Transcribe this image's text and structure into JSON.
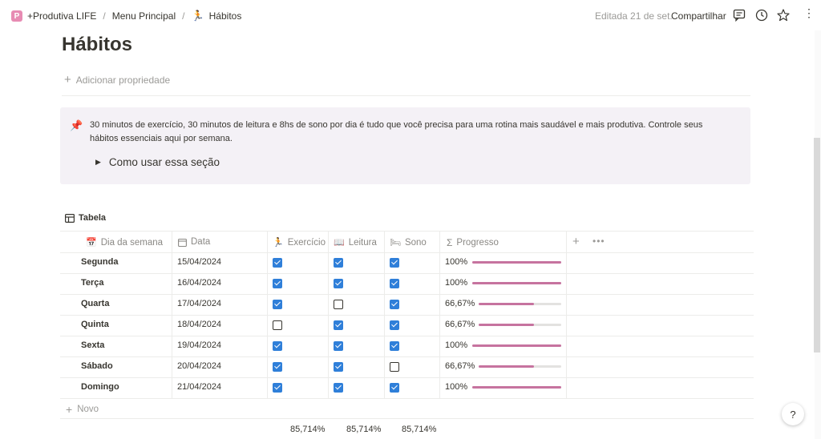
{
  "breadcrumb": {
    "workspace": "+Produtiva LIFE",
    "parent": "Menu Principal",
    "current": "Hábitos",
    "separator": "/"
  },
  "topbar": {
    "edited": "Editada 21 de set.",
    "share": "Compartilhar"
  },
  "page": {
    "title": "Hábitos",
    "add_property": "Adicionar propriedade"
  },
  "callout": {
    "icon": "pushpin-icon",
    "text": "30 minutos de exercício, 30 minutos de leitura e 8hs de sono por dia é tudo que você precisa para uma rotina mais saudável e mais produtiva. Controle seus hábitos essenciais aqui por semana.",
    "toggle_label": "Como usar essa seção"
  },
  "table": {
    "view_name": "Tabela",
    "headers": {
      "day": "Dia da semana",
      "date": "Data",
      "exercise": "Exercício",
      "reading": "Leitura",
      "sleep": "Sono",
      "progress": "Progresso"
    },
    "rows": [
      {
        "day": "Segunda",
        "date": "15/04/2024",
        "exercise": true,
        "reading": true,
        "sleep": true,
        "progress_label": "100%",
        "progress": 1.0
      },
      {
        "day": "Terça",
        "date": "16/04/2024",
        "exercise": true,
        "reading": true,
        "sleep": true,
        "progress_label": "100%",
        "progress": 1.0
      },
      {
        "day": "Quarta",
        "date": "17/04/2024",
        "exercise": true,
        "reading": false,
        "sleep": true,
        "progress_label": "66,67%",
        "progress": 0.6667
      },
      {
        "day": "Quinta",
        "date": "18/04/2024",
        "exercise": false,
        "reading": true,
        "sleep": true,
        "progress_label": "66,67%",
        "progress": 0.6667
      },
      {
        "day": "Sexta",
        "date": "19/04/2024",
        "exercise": true,
        "reading": true,
        "sleep": true,
        "progress_label": "100%",
        "progress": 1.0
      },
      {
        "day": "Sábado",
        "date": "20/04/2024",
        "exercise": true,
        "reading": true,
        "sleep": false,
        "progress_label": "66,67%",
        "progress": 0.6667
      },
      {
        "day": "Domingo",
        "date": "21/04/2024",
        "exercise": true,
        "reading": true,
        "sleep": true,
        "progress_label": "100%",
        "progress": 1.0
      }
    ],
    "new_row": "Novo",
    "totals": {
      "exercise": "85,714%",
      "reading": "85,714%",
      "sleep": "85,714%"
    }
  },
  "colors": {
    "checkbox": "#2f7fd9",
    "progress_bar": "#c6739f",
    "callout_bg": "#f4f1f6"
  }
}
